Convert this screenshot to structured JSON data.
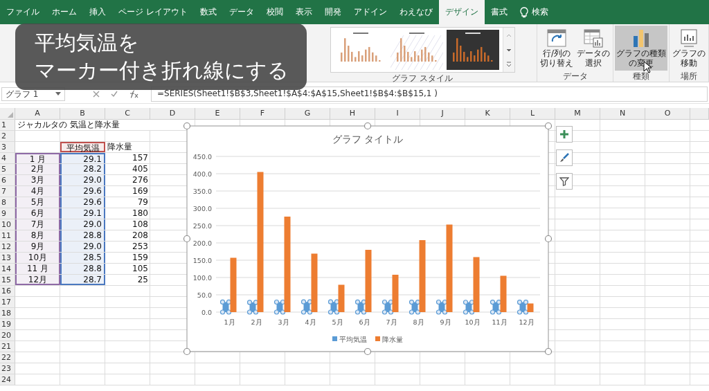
{
  "tabs": [
    {
      "label": "ファイル",
      "selected": false
    },
    {
      "label": "ホーム",
      "selected": false
    },
    {
      "label": "挿入",
      "selected": false
    },
    {
      "label": "ページ レイアウト",
      "selected": false
    },
    {
      "label": "数式",
      "selected": false
    },
    {
      "label": "データ",
      "selected": false
    },
    {
      "label": "校閲",
      "selected": false
    },
    {
      "label": "表示",
      "selected": false
    },
    {
      "label": "開発",
      "selected": false
    },
    {
      "label": "アドイン",
      "selected": false
    },
    {
      "label": "わえなび",
      "selected": false
    },
    {
      "label": "デザイン",
      "selected": true
    },
    {
      "label": "書式",
      "selected": false
    }
  ],
  "search": {
    "label": "検索"
  },
  "caption": {
    "lines": [
      "平均気温を",
      "マーカー付き折れ線にする"
    ]
  },
  "ribbon": {
    "style_group": {
      "label": "グラフ スタイル",
      "thumbnails": [
        {
          "kind": "light"
        },
        {
          "kind": "hatched"
        },
        {
          "kind": "dark"
        }
      ]
    },
    "groups": [
      {
        "label": "データ",
        "buttons": [
          {
            "lines": [
              "行/列の",
              "切り替え"
            ],
            "kind": "switch",
            "highlighted": false
          },
          {
            "lines": [
              "データの",
              "選択"
            ],
            "kind": "select",
            "highlighted": false
          }
        ]
      },
      {
        "label": "種類",
        "buttons": [
          {
            "lines": [
              "グラフの種類",
              "の変更"
            ],
            "kind": "type",
            "highlighted": true
          }
        ]
      },
      {
        "label": "場所",
        "buttons": [
          {
            "lines": [
              "グラフの",
              "移動"
            ],
            "kind": "move",
            "highlighted": false
          }
        ]
      }
    ]
  },
  "formula_bar": {
    "name_box": "グラフ 1",
    "formula": "=SERIES(Sheet1!$B$3,Sheet1!$A$4:$A$15,Sheet1!$B$4:$B$15,1 )"
  },
  "sheet": {
    "columns": [
      "A",
      "B",
      "C",
      "D",
      "E",
      "F",
      "G",
      "H",
      "I",
      "J",
      "K",
      "L",
      "M",
      "N",
      "O"
    ],
    "rows": [
      {
        "number": "1",
        "cells": {
          "A": {
            "text": "ジャカルタの 気温と降水量",
            "kind": "text"
          }
        }
      },
      {
        "number": "2"
      },
      {
        "number": "3",
        "cells": {
          "B": {
            "text": "平均気温",
            "kind": "center",
            "color": "#c0504d"
          },
          "C": {
            "text": "降水量",
            "kind": "text"
          }
        }
      },
      {
        "number": "4",
        "cells": {
          "A": {
            "text": "1 月",
            "kind": "center",
            "color": "#8e6aa6"
          },
          "B": {
            "text": "29.1",
            "kind": "number",
            "color": "#4a78c0"
          },
          "C": {
            "text": "157",
            "kind": "number"
          }
        }
      },
      {
        "number": "5",
        "cells": {
          "A": {
            "text": "2月",
            "kind": "center",
            "color": "#8e6aa6"
          },
          "B": {
            "text": "28.2",
            "kind": "number",
            "color": "#4a78c0"
          },
          "C": {
            "text": "405",
            "kind": "number"
          }
        }
      },
      {
        "number": "6",
        "cells": {
          "A": {
            "text": "3月",
            "kind": "center",
            "color": "#8e6aa6"
          },
          "B": {
            "text": "29.0",
            "kind": "number",
            "color": "#4a78c0"
          },
          "C": {
            "text": "276",
            "kind": "number"
          }
        }
      },
      {
        "number": "7",
        "cells": {
          "A": {
            "text": "4月",
            "kind": "center",
            "color": "#8e6aa6"
          },
          "B": {
            "text": "29.6",
            "kind": "number",
            "color": "#4a78c0"
          },
          "C": {
            "text": "169",
            "kind": "number"
          }
        }
      },
      {
        "number": "8",
        "cells": {
          "A": {
            "text": "5月",
            "kind": "center",
            "color": "#8e6aa6"
          },
          "B": {
            "text": "29.6",
            "kind": "number",
            "color": "#4a78c0"
          },
          "C": {
            "text": "79",
            "kind": "number"
          }
        }
      },
      {
        "number": "9",
        "cells": {
          "A": {
            "text": "6月",
            "kind": "center",
            "color": "#8e6aa6"
          },
          "B": {
            "text": "29.1",
            "kind": "number",
            "color": "#4a78c0"
          },
          "C": {
            "text": "180",
            "kind": "number"
          }
        }
      },
      {
        "number": "10",
        "cells": {
          "A": {
            "text": "7月",
            "kind": "center",
            "color": "#8e6aa6"
          },
          "B": {
            "text": "29.0",
            "kind": "number",
            "color": "#4a78c0"
          },
          "C": {
            "text": "108",
            "kind": "number"
          }
        }
      },
      {
        "number": "11",
        "cells": {
          "A": {
            "text": "8月",
            "kind": "center",
            "color": "#8e6aa6"
          },
          "B": {
            "text": "28.8",
            "kind": "number",
            "color": "#4a78c0"
          },
          "C": {
            "text": "208",
            "kind": "number"
          }
        }
      },
      {
        "number": "12",
        "cells": {
          "A": {
            "text": "9月",
            "kind": "center",
            "color": "#8e6aa6"
          },
          "B": {
            "text": "29.0",
            "kind": "number",
            "color": "#4a78c0"
          },
          "C": {
            "text": "253",
            "kind": "number"
          }
        }
      },
      {
        "number": "13",
        "cells": {
          "A": {
            "text": "10月",
            "kind": "center",
            "color": "#8e6aa6"
          },
          "B": {
            "text": "28.5",
            "kind": "number",
            "color": "#4a78c0"
          },
          "C": {
            "text": "159",
            "kind": "number"
          }
        }
      },
      {
        "number": "14",
        "cells": {
          "A": {
            "text": "11 月",
            "kind": "center",
            "color": "#8e6aa6"
          },
          "B": {
            "text": "28.8",
            "kind": "number",
            "color": "#4a78c0"
          },
          "C": {
            "text": "105",
            "kind": "number"
          }
        }
      },
      {
        "number": "15",
        "cells": {
          "A": {
            "text": "12月",
            "kind": "center",
            "color": "#8e6aa6"
          },
          "B": {
            "text": "28.7",
            "kind": "number",
            "color": "#4a78c0"
          },
          "C": {
            "text": "25",
            "kind": "number"
          }
        }
      },
      {
        "number": "16"
      },
      {
        "number": "17"
      },
      {
        "number": "18"
      },
      {
        "number": "19"
      },
      {
        "number": "20"
      },
      {
        "number": "21"
      },
      {
        "number": "22"
      },
      {
        "number": "23"
      },
      {
        "number": "24"
      }
    ]
  },
  "chart": {
    "series_selection": [
      {
        "selected": true
      },
      {
        "selected": false
      }
    ],
    "chart_data": {
      "type": "bar",
      "title": "グラフ タイトル",
      "categories": [
        "1月",
        "2月",
        "3月",
        "4月",
        "5月",
        "6月",
        "7月",
        "8月",
        "9月",
        "10月",
        "11月",
        "12月"
      ],
      "series": [
        {
          "name": "平均気温",
          "color": "#5b9bd5",
          "values": [
            29.1,
            28.2,
            29.0,
            29.6,
            29.6,
            29.1,
            29.0,
            28.8,
            29.0,
            28.5,
            28.8,
            28.7
          ]
        },
        {
          "name": "降水量",
          "color": "#ed7d31",
          "values": [
            157,
            405,
            276,
            169,
            79,
            180,
            108,
            208,
            253,
            159,
            105,
            25
          ]
        }
      ],
      "ylim": [
        0,
        450
      ],
      "yticks": [
        {
          "value": 0,
          "label": "0.0"
        },
        {
          "value": 50,
          "label": "50.0"
        },
        {
          "value": 100,
          "label": "100.0"
        },
        {
          "value": 150,
          "label": "150.0"
        },
        {
          "value": 200,
          "label": "200.0"
        },
        {
          "value": 250,
          "label": "250.0"
        },
        {
          "value": 300,
          "label": "300.0"
        },
        {
          "value": 350,
          "label": "350.0"
        },
        {
          "value": 400,
          "label": "400.0"
        },
        {
          "value": 450,
          "label": "450.0"
        }
      ],
      "grid": true,
      "legend": true
    }
  }
}
